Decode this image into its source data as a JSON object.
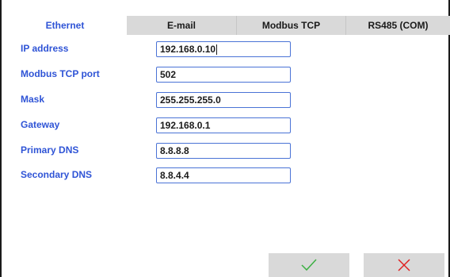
{
  "tabs": [
    {
      "label": "Ethernet",
      "active": true
    },
    {
      "label": "E-mail",
      "active": false
    },
    {
      "label": "Modbus TCP",
      "active": false
    },
    {
      "label": "RS485 (COM)",
      "active": false
    }
  ],
  "fields": [
    {
      "label": "IP address",
      "value": "192.168.0.10"
    },
    {
      "label": "Modbus TCP port",
      "value": "502"
    },
    {
      "label": "Mask",
      "value": "255.255.255.0"
    },
    {
      "label": "Gateway",
      "value": "192.168.0.1"
    },
    {
      "label": "Primary DNS",
      "value": "8.8.8.8"
    },
    {
      "label": "Secondary DNS",
      "value": "8.8.4.4"
    }
  ],
  "actions": {
    "confirm_icon": "checkmark-icon",
    "cancel_icon": "close-icon",
    "confirm_color": "#3cb043",
    "cancel_color": "#e02020"
  },
  "colors": {
    "accent": "#2f54d6",
    "field_border": "#4a73d6",
    "tab_inactive_bg": "#d9d9d9"
  }
}
